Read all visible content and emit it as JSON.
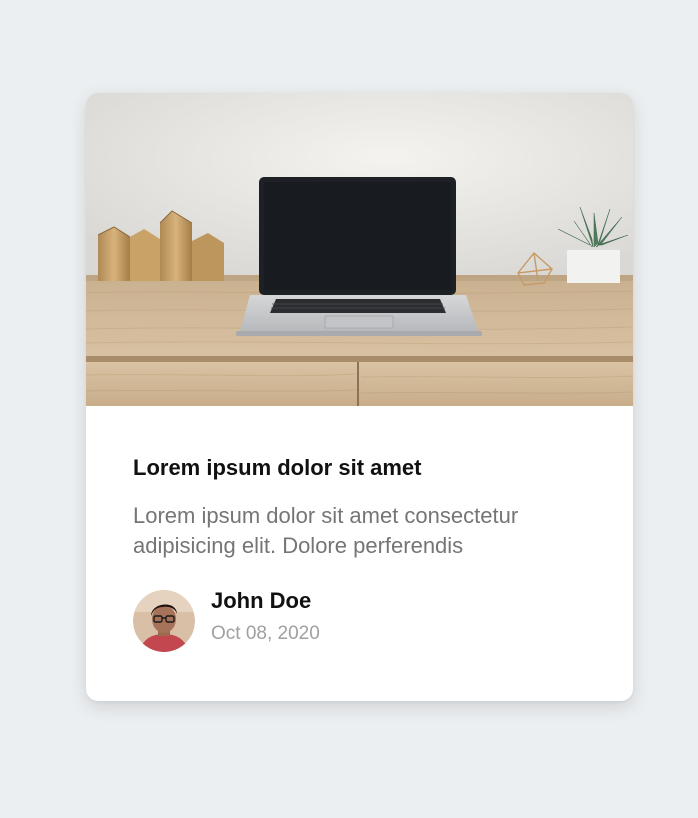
{
  "card": {
    "image_alt": "Laptop on a wooden desk",
    "title": "Lorem ipsum dolor sit amet",
    "text": "Lorem ipsum dolor sit amet consectetur adipisicing elit. Dolore perferendis"
  },
  "author": {
    "name": "John Doe",
    "date": "Oct 08, 2020"
  },
  "colors": {
    "background": "#eceff1",
    "card": "#ffffff",
    "title": "#111111",
    "text": "#757575",
    "date": "#a0a0a0"
  }
}
